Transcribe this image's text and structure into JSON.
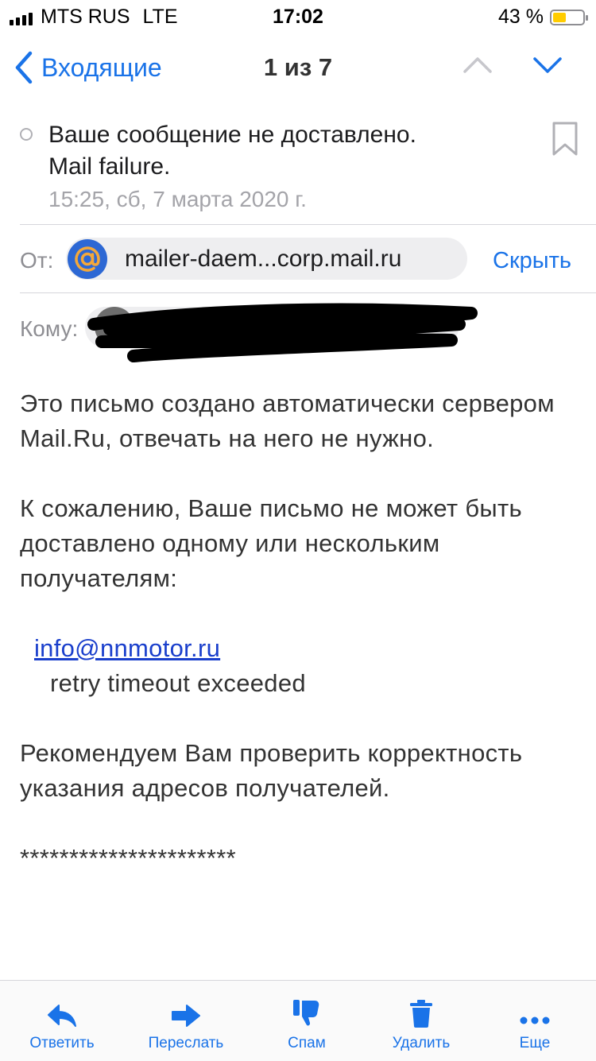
{
  "status_bar": {
    "carrier": "MTS RUS",
    "network": "LTE",
    "time": "17:02",
    "battery": "43 %"
  },
  "nav": {
    "back_label": "Входящие",
    "counter": "1 из 7"
  },
  "message": {
    "subject_line1": "Ваше сообщение не доставлено.",
    "subject_line2": "Mail failure.",
    "date": "15:25, сб, 7 марта 2020 г.",
    "from_label": "От:",
    "sender": "mailer-daem...corp.mail.ru",
    "hide_label": "Скрыть",
    "to_label": "Кому:"
  },
  "body": {
    "p1": "Это письмо создано автоматически сервером Mail.Ru, отвечать на него не нужно.",
    "p2": "К сожалению, Ваше письмо не может быть доставлено одному или нескольким получателям:",
    "address": "info@nnmotor.ru",
    "reason": "retry timeout exceeded",
    "p3": "Рекомендуем Вам проверить корректность указания адресов получателей.",
    "divider": "**********************"
  },
  "toolbar": {
    "reply": "Ответить",
    "forward": "Переслать",
    "spam": "Спам",
    "delete": "Удалить",
    "more": "Еще"
  },
  "colors": {
    "accent": "#1a73e8",
    "avatar_bg": "#2d68d4",
    "avatar_at": "#f4a83a",
    "battery": "#ffcc00"
  }
}
